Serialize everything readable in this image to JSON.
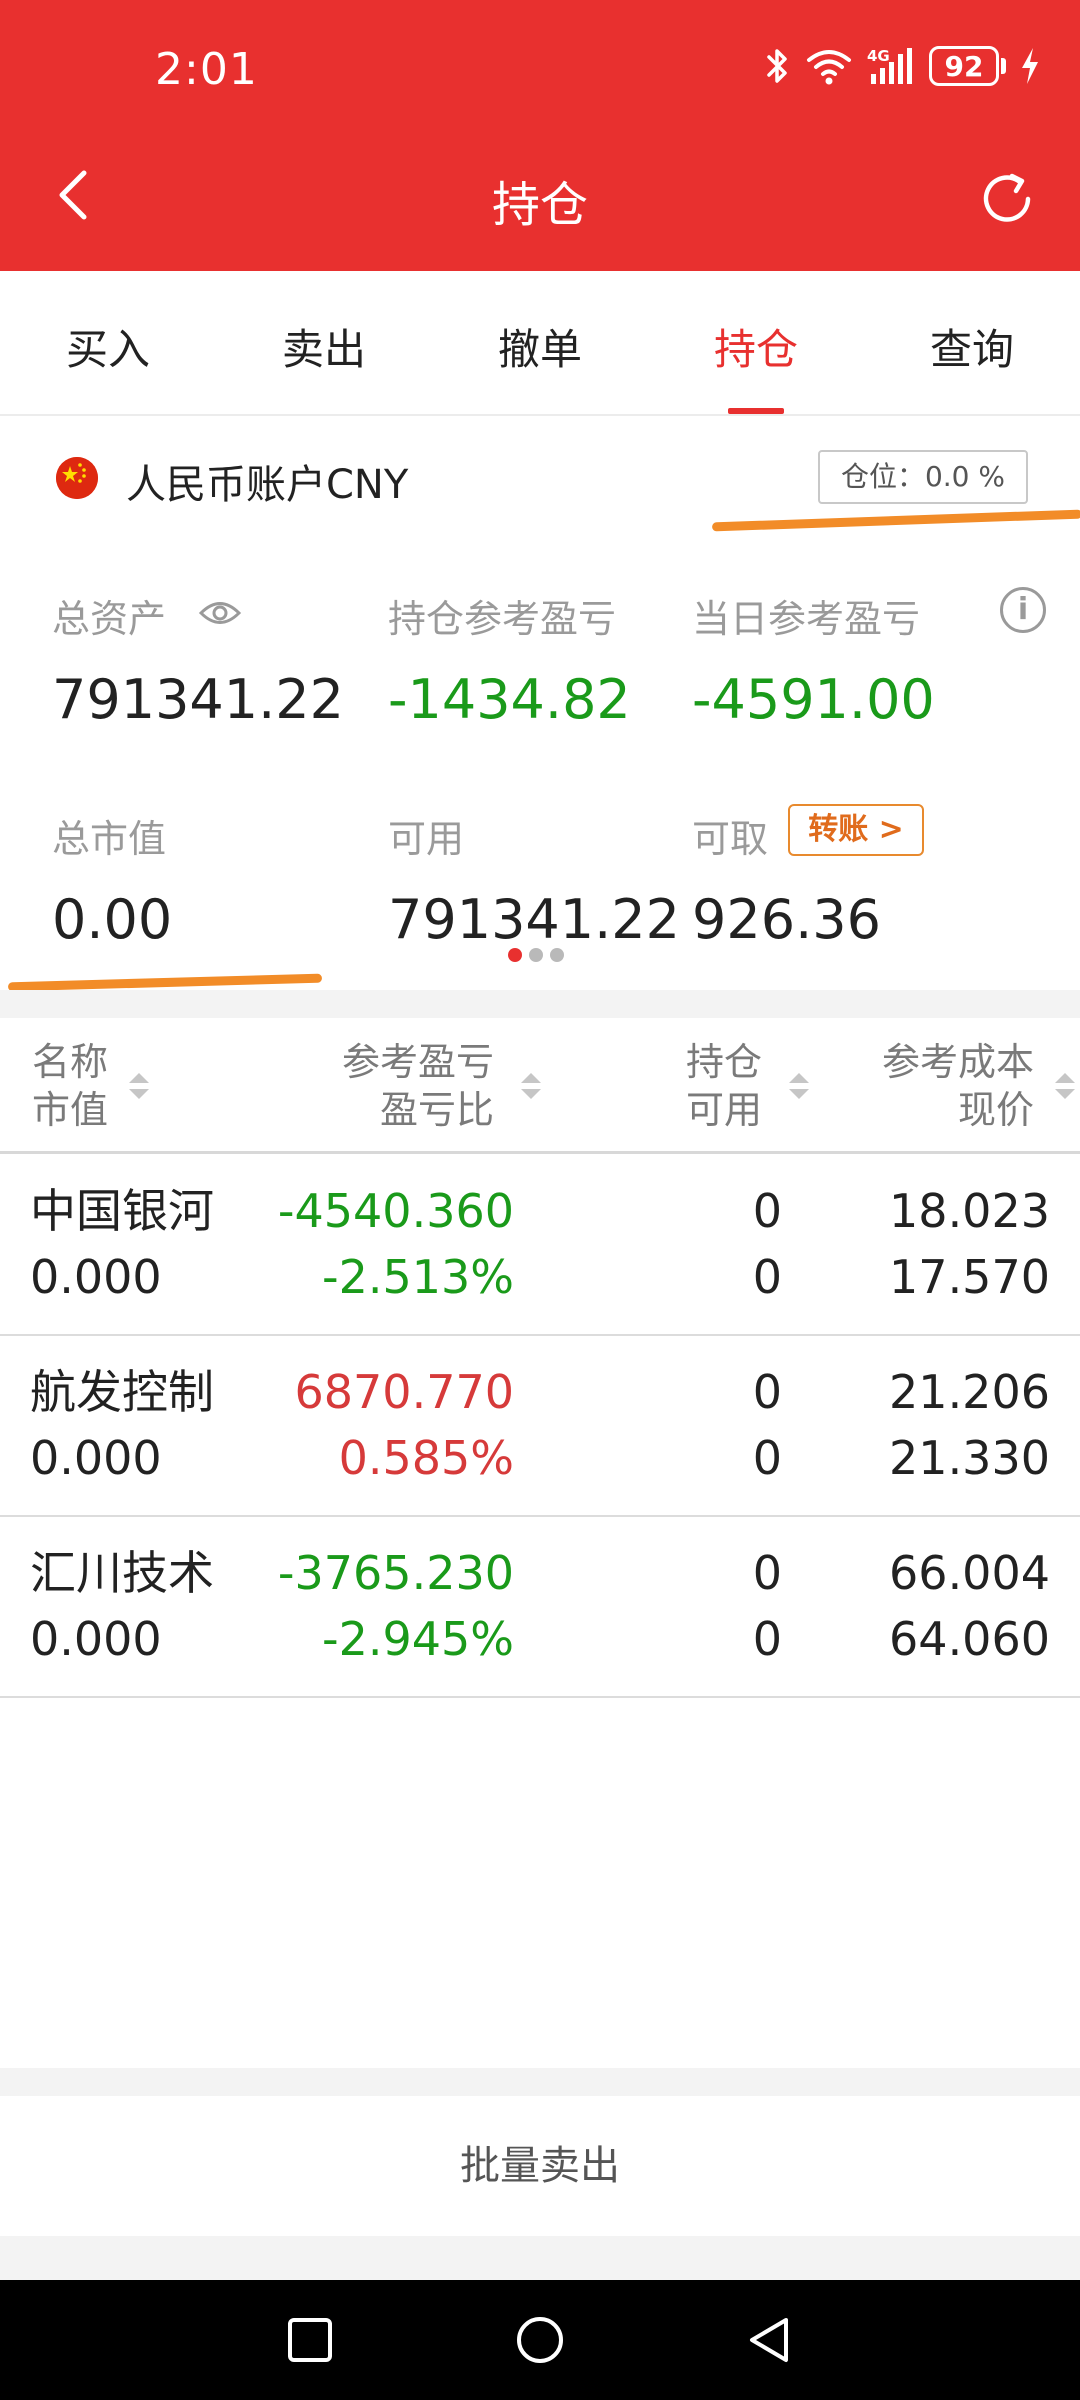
{
  "status_bar": {
    "time": "2:01",
    "battery": "92"
  },
  "nav": {
    "title": "持仓"
  },
  "tabs": [
    {
      "label": "买入",
      "active": false
    },
    {
      "label": "卖出",
      "active": false
    },
    {
      "label": "撤单",
      "active": false
    },
    {
      "label": "持仓",
      "active": true
    },
    {
      "label": "查询",
      "active": false
    }
  ],
  "account": {
    "name": "人民币账户CNY",
    "position_ratio": "仓位：0.0 %"
  },
  "summary": {
    "total_assets_label": "总资产",
    "total_assets": "791341.22",
    "holding_pl_label": "持仓参考盈亏",
    "holding_pl": "-1434.82",
    "daily_pl_label": "当日参考盈亏",
    "daily_pl": "-4591.00",
    "market_value_label": "总市值",
    "market_value": "0.00",
    "available_label": "可用",
    "available": "791341.22",
    "withdrawable_label": "可取",
    "withdrawable": "926.36",
    "transfer_label": "转账 >"
  },
  "table": {
    "headers": {
      "name": "名称",
      "market_value": "市值",
      "ref_pl": "参考盈亏",
      "pl_ratio": "盈亏比",
      "holding": "持仓",
      "available": "可用",
      "ref_cost": "参考成本",
      "current_price": "现价"
    },
    "rows": [
      {
        "name": "中国银河",
        "market_value": "0.000",
        "ref_pl": "-4540.360",
        "pl_ratio": "-2.513%",
        "holding": "0",
        "available": "0",
        "ref_cost": "18.023",
        "current_price": "17.570",
        "trend": "down"
      },
      {
        "name": "航发控制",
        "market_value": "0.000",
        "ref_pl": "6870.770",
        "pl_ratio": "0.585%",
        "holding": "0",
        "available": "0",
        "ref_cost": "21.206",
        "current_price": "21.330",
        "trend": "up"
      },
      {
        "name": "汇川技术",
        "market_value": "0.000",
        "ref_pl": "-3765.230",
        "pl_ratio": "-2.945%",
        "holding": "0",
        "available": "0",
        "ref_cost": "66.004",
        "current_price": "64.060",
        "trend": "down"
      }
    ]
  },
  "footer": {
    "batch_sell_label": "批量卖出"
  },
  "colors": {
    "brand_red": "#e8302f",
    "gain_red": "#d63a3a",
    "loss_green": "#1a9a1a",
    "highlight_orange": "#f28c28"
  }
}
